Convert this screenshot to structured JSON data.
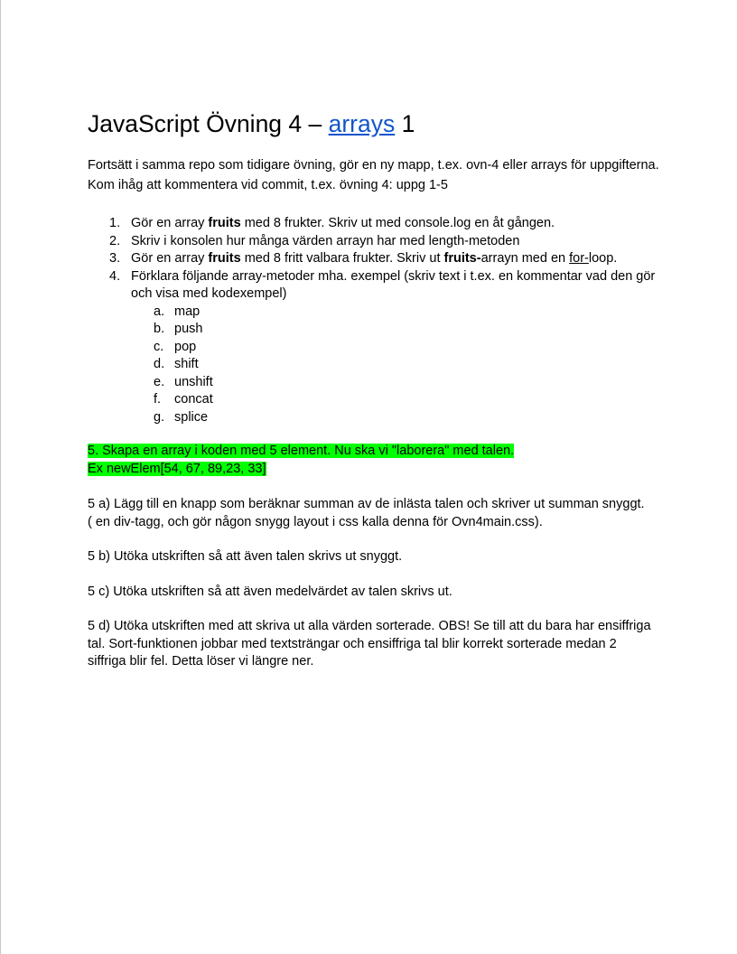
{
  "title": {
    "before": "JavaScript Övning 4 – ",
    "link": "arrays",
    "after": " 1"
  },
  "intro": "Fortsätt i samma repo som tidigare övning, gör en ny mapp, t.ex. ovn-4 eller arrays för uppgifterna. Kom ihåg att kommentera vid commit, t.ex. övning 4: uppg 1-5",
  "tasks": {
    "t1": {
      "num": "1.",
      "a": "Gör en array ",
      "b": "fruits",
      "c": " med 8 frukter. Skriv ut med console.log en åt gången."
    },
    "t2": {
      "num": "2.",
      "text": "Skriv i konsolen hur många värden arrayn har med length-metoden"
    },
    "t3": {
      "num": "3.",
      "a": "Gör en array ",
      "b": "fruits",
      "c": " med 8 fritt valbara frukter. Skriv ut ",
      "d": "fruits-",
      "e": "arrayn med en ",
      "f": "for-",
      "g": "loop."
    },
    "t4": {
      "num": "4.",
      "text": "Förklara följande array-metoder mha. exempel (skriv text i t.ex. en kommentar vad den gör och visa med kodexempel)"
    }
  },
  "methods": [
    {
      "letter": "a.",
      "name": "map"
    },
    {
      "letter": "b.",
      "name": "push"
    },
    {
      "letter": "c.",
      "name": "pop"
    },
    {
      "letter": "d.",
      "name": "shift"
    },
    {
      "letter": "e.",
      "name": "unshift"
    },
    {
      "letter": "f.",
      "name": "concat"
    },
    {
      "letter": "g.",
      "name": "splice"
    }
  ],
  "task5": {
    "line1": "5. Skapa en array i koden med 5 element. Nu ska vi \"laborera\" med talen.",
    "line2": "Ex newElem[54, 67, 89,23, 33]"
  },
  "task5a": {
    "line1": "5 a) Lägg till en knapp som beräknar summan av de inlästa talen och skriver ut summan snyggt.",
    "line2": "( en div-tagg, och gör någon snygg layout i css kalla denna för Ovn4main.css)."
  },
  "task5b": "5 b) Utöka utskriften så att även talen skrivs ut snyggt.",
  "task5c": "5 c) Utöka utskriften så att även medelvärdet av talen skrivs ut.",
  "task5d": "5 d) Utöka utskriften med att skriva ut alla värden sorterade. OBS! Se till att du bara har ensiffriga tal. Sort-funktionen jobbar med textsträngar och ensiffriga tal blir korrekt sorterade medan 2 siffriga blir fel. Detta löser vi längre ner.",
  "colors": {
    "link": "#1155cc",
    "highlight": "#00ff00"
  }
}
